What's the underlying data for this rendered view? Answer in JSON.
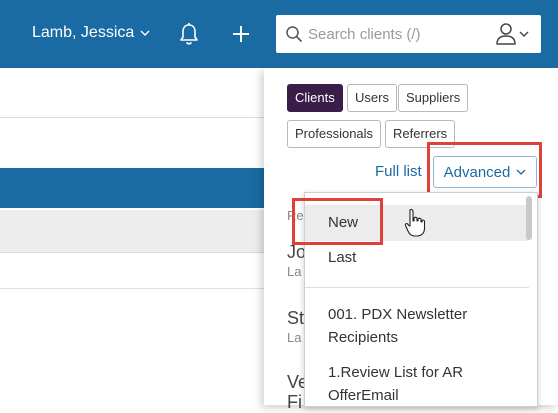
{
  "header": {
    "user_name": "Lamb, Jessica",
    "search_placeholder": "Search clients (/)",
    "icons": [
      "chevron-down-icon",
      "bell-icon",
      "plus-icon",
      "search-icon",
      "user-icon"
    ]
  },
  "filters": {
    "buttons": [
      {
        "label": "Clients",
        "active": true
      },
      {
        "label": "Users",
        "active": false
      },
      {
        "label": "Suppliers",
        "active": false
      },
      {
        "label": "Professionals",
        "active": false
      },
      {
        "label": "Referrers",
        "active": false
      }
    ],
    "full_list_label": "Full list",
    "advanced_label": "Advanced"
  },
  "results_partial": {
    "heading": "Re",
    "items": [
      {
        "name": "Jo",
        "sub": "La"
      },
      {
        "name": "St",
        "sub": "La"
      },
      {
        "name": "Ve",
        "sub": "Fi"
      }
    ]
  },
  "advanced_menu": {
    "items": [
      "New",
      "Last",
      "001. PDX Newsletter Recipients",
      "1.Review List for AR OfferEmail"
    ],
    "item_lines": [
      [
        "New"
      ],
      [
        "Last"
      ],
      [
        "001. PDX Newsletter",
        "Recipients"
      ],
      [
        "1.Review List for AR",
        "OfferEmail"
      ]
    ],
    "hovered": "New"
  },
  "colors": {
    "header_bg": "#1a6ba3",
    "active_filter": "#3b1d4a",
    "highlight": "#e0403a",
    "link": "#1a6ba3"
  }
}
